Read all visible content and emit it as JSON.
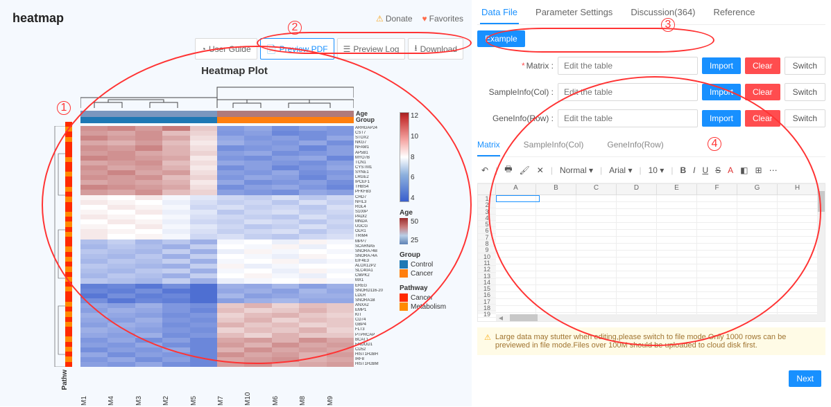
{
  "header": {
    "title": "heatmap",
    "donate": "Donate",
    "favorites": "Favorites"
  },
  "toolbar": {
    "user_guide": "User Guide",
    "preview_pdf": "Preview PDF",
    "preview_log": "Preview Log",
    "download": "Download"
  },
  "plot": {
    "title": "Heatmap Plot",
    "annot_labels": {
      "age": "Age",
      "group": "Group"
    },
    "axis_pathway": "Pathw",
    "row_names": [
      "ARHGAP24",
      "CST7",
      "STOX2",
      "NKG7",
      "NFAM1",
      "AP5B1",
      "MYO7B",
      "TCN1",
      "CYSTM1",
      "SYNE1",
      "LRGE2",
      "IPCEF1",
      "THBS4",
      "PFKFB3",
      "CHD7",
      "NFIL3",
      "RGL4",
      "S100P",
      "PADI2",
      "MNDA",
      "UGCG",
      "OLR1",
      "TRIM4",
      "MPP7",
      "SCARNA5",
      "SNORA74B",
      "SNORA74A",
      "EIF4E3",
      "ALOX12P2",
      "SLC40A1",
      "CMPK2",
      "MX1",
      "EREG",
      "SNORD116-20",
      "LDLR",
      "SNORA1B",
      "ANXA2",
      "EMP1",
      "KIT",
      "CD74",
      "GBP4",
      "FLT3",
      "PTPRCAP",
      "BCAT1",
      "ENDOD1",
      "CD52",
      "HIST1H2BH",
      "IRF8",
      "HIST1H2BM"
    ],
    "col_names": [
      "M1",
      "M4",
      "M3",
      "M2",
      "M5",
      "M7",
      "M10",
      "M6",
      "M8",
      "M9"
    ],
    "top_ann_age": [
      "#7a97bf",
      "#7a97bf",
      "#7a97bf",
      "#7a97bf",
      "#7a97bf",
      "#b07a7a",
      "#b07a7a",
      "#b07a7a",
      "#b07a7a",
      "#b07a7a"
    ],
    "top_ann_group": [
      "#1e78b4",
      "#1e78b4",
      "#1e78b4",
      "#1e78b4",
      "#1e78b4",
      "#ff7f0e",
      "#ff7f0e",
      "#ff7f0e",
      "#ff7f0e",
      "#ff7f0e"
    ],
    "row_ann": [
      "#ff2a00",
      "#ff8a00",
      "#ff2a00",
      "#ff8a00",
      "#ff2a00",
      "#ff2a00",
      "#ff2a00",
      "#ff8a00",
      "#ff2a00",
      "#ff2a00",
      "#ff8a00",
      "#ff2a00",
      "#ff2a00",
      "#ff8a00",
      "#ff2a00",
      "#ff8a00",
      "#ff2a00",
      "#ff2a00",
      "#ff8a00",
      "#ff2a00",
      "#ff8a00",
      "#ff2a00",
      "#ff8a00",
      "#ff2a00",
      "#ff2a00",
      "#ff8a00",
      "#ff2a00",
      "#ff8a00",
      "#ff2a00",
      "#ff8a00",
      "#ff2a00",
      "#ff8a00",
      "#ff2a00",
      "#ff8a00",
      "#ff2a00",
      "#ff2a00",
      "#ff8a00",
      "#ff2a00",
      "#ff8a00",
      "#ff2a00",
      "#ff8a00",
      "#ff2a00",
      "#ff2a00",
      "#ff8a00",
      "#ff2a00",
      "#ff8a00",
      "#ff2a00",
      "#ff8a00",
      "#ff2a00"
    ]
  },
  "legend": {
    "colorbar_ticks": [
      "12",
      "10",
      "8",
      "6",
      "4"
    ],
    "age": {
      "title": "Age",
      "ticks": [
        "50",
        "25"
      ]
    },
    "group": {
      "title": "Group",
      "items": [
        {
          "label": "Control",
          "color": "#1e78b4"
        },
        {
          "label": "Cancer",
          "color": "#ff7f0e"
        }
      ]
    },
    "pathway": {
      "title": "Pathway",
      "items": [
        {
          "label": "Cancer",
          "color": "#ff2a00"
        },
        {
          "label": "Metabolism",
          "color": "#ff8a00"
        }
      ]
    }
  },
  "tabs": {
    "data_file": "Data File",
    "param": "Parameter Settings",
    "discussion": "Discussion(364)",
    "reference": "Reference"
  },
  "buttons": {
    "example": "Example",
    "import": "Import",
    "clear": "Clear",
    "switch": "Switch",
    "next": "Next"
  },
  "fields": {
    "matrix": "Matrix :",
    "sampleinfo": "SampleInfo(Col) :",
    "geneinfo": "GeneInfo(Row) :",
    "placeholder": "Edit the table"
  },
  "subtabs": {
    "matrix": "Matrix",
    "sample": "SampleInfo(Col)",
    "gene": "GeneInfo(Row)"
  },
  "sheet": {
    "toolbar": {
      "undo": "↶",
      "print": "🖶",
      "paint": "🖌",
      "clearfmt": "✕",
      "normal": "Normal",
      "font": "Arial",
      "size": "10",
      "bold": "B",
      "italic": "I",
      "under": "U",
      "strike": "S",
      "color": "A",
      "fill": "◧",
      "borders": "⊞",
      "more": "⋯"
    },
    "cols": [
      "A",
      "B",
      "C",
      "D",
      "E",
      "F",
      "G",
      "H"
    ],
    "rows": [
      "1",
      "2",
      "3",
      "4",
      "5",
      "6",
      "7",
      "8",
      "9",
      "10",
      "11",
      "12",
      "13",
      "14",
      "15",
      "16",
      "17",
      "18",
      "19"
    ]
  },
  "warning": "Large data may stutter when editing,please switch to file mode.Only 1000 rows can be previewed in file mode.Files over 100M should be uploaded to cloud disk first.",
  "annotations": {
    "1": "1",
    "2": "2",
    "3": "3",
    "4": "4"
  },
  "chart_data": {
    "type": "heatmap",
    "title": "Heatmap Plot",
    "x_categories": [
      "M1",
      "M4",
      "M3",
      "M2",
      "M5",
      "M7",
      "M10",
      "M6",
      "M8",
      "M9"
    ],
    "y_categories": [
      "ARHGAP24",
      "CST7",
      "STOX2",
      "NKG7",
      "NFAM1",
      "AP5B1",
      "MYO7B",
      "TCN1",
      "CYSTM1",
      "SYNE1",
      "LRGE2",
      "IPCEF1",
      "THBS4",
      "PFKFB3",
      "CHD7",
      "NFIL3",
      "RGL4",
      "S100P",
      "PADI2",
      "MNDA",
      "UGCG",
      "OLR1",
      "TRIM4",
      "MPP7",
      "SCARNA5",
      "SNORA74B",
      "SNORA74A",
      "EIF4E3",
      "ALOX12P2",
      "SLC40A1",
      "CMPK2",
      "MX1",
      "EREG",
      "SNORD116-20",
      "LDLR",
      "SNORA1B",
      "ANXA2",
      "EMP1",
      "KIT",
      "CD74",
      "GBP4",
      "FLT3",
      "PTPRCAP",
      "BCAT1",
      "ENDOD1",
      "CD52",
      "HIST1H2BH",
      "IRF8",
      "HIST1H2BM"
    ],
    "color_scale": {
      "min": 4,
      "max": 12,
      "low": "#3a5fcd",
      "mid": "#ffffff",
      "high": "#a02222"
    },
    "col_annotations": {
      "Age": [
        30,
        28,
        32,
        29,
        31,
        48,
        50,
        47,
        49,
        46
      ],
      "Group": [
        "Control",
        "Control",
        "Control",
        "Control",
        "Control",
        "Cancer",
        "Cancer",
        "Cancer",
        "Cancer",
        "Cancer"
      ]
    },
    "row_annotation_pathway": [
      "Cancer",
      "Metabolism",
      "Cancer",
      "Metabolism",
      "Cancer",
      "Cancer",
      "Cancer",
      "Metabolism",
      "Cancer",
      "Cancer",
      "Metabolism",
      "Cancer",
      "Cancer",
      "Metabolism",
      "Cancer",
      "Metabolism",
      "Cancer",
      "Cancer",
      "Metabolism",
      "Cancer",
      "Metabolism",
      "Cancer",
      "Metabolism",
      "Cancer",
      "Cancer",
      "Metabolism",
      "Cancer",
      "Metabolism",
      "Cancer",
      "Metabolism",
      "Cancer",
      "Metabolism",
      "Cancer",
      "Metabolism",
      "Cancer",
      "Cancer",
      "Metabolism",
      "Cancer",
      "Metabolism",
      "Cancer",
      "Metabolism",
      "Cancer",
      "Cancer",
      "Metabolism",
      "Cancer",
      "Metabolism",
      "Cancer",
      "Metabolism",
      "Cancer"
    ],
    "matrix": [
      [
        10.0,
        10.2,
        9.8,
        10.4,
        9.0,
        5.5,
        5.8,
        5.2,
        5.6,
        5.4
      ],
      [
        9.8,
        9.6,
        10.0,
        9.2,
        8.8,
        5.4,
        5.6,
        5.0,
        5.2,
        5.4
      ],
      [
        10.2,
        9.8,
        10.0,
        9.6,
        8.6,
        5.8,
        5.4,
        5.6,
        5.2,
        5.8
      ],
      [
        9.6,
        9.4,
        9.8,
        9.2,
        8.4,
        6.0,
        5.6,
        5.4,
        5.8,
        5.2
      ],
      [
        10.0,
        9.8,
        10.2,
        9.4,
        8.6,
        5.2,
        5.4,
        5.6,
        5.0,
        5.6
      ],
      [
        9.8,
        10.0,
        9.6,
        9.4,
        8.8,
        5.6,
        5.8,
        5.2,
        5.4,
        5.6
      ],
      [
        10.2,
        10.0,
        9.8,
        9.6,
        8.4,
        5.4,
        5.2,
        5.6,
        5.8,
        5.0
      ],
      [
        9.6,
        9.8,
        10.0,
        9.2,
        8.6,
        5.8,
        5.6,
        5.4,
        5.2,
        5.6
      ],
      [
        10.0,
        9.6,
        9.8,
        9.4,
        8.4,
        5.2,
        5.6,
        5.0,
        5.4,
        5.8
      ],
      [
        9.8,
        10.2,
        9.6,
        9.8,
        8.6,
        5.6,
        5.4,
        5.8,
        5.2,
        5.4
      ],
      [
        10.0,
        9.8,
        10.0,
        9.2,
        8.8,
        5.4,
        5.8,
        5.6,
        5.0,
        5.6
      ],
      [
        9.6,
        9.8,
        9.6,
        9.4,
        8.4,
        5.8,
        5.2,
        5.4,
        5.6,
        5.2
      ],
      [
        10.2,
        10.0,
        9.8,
        9.6,
        8.6,
        5.2,
        5.6,
        5.8,
        5.4,
        5.0
      ],
      [
        9.8,
        9.6,
        10.0,
        9.2,
        8.8,
        5.6,
        5.4,
        5.2,
        5.8,
        5.6
      ],
      [
        8.2,
        8.0,
        8.4,
        7.8,
        7.4,
        7.0,
        6.8,
        7.2,
        6.6,
        7.0
      ],
      [
        8.4,
        8.2,
        8.0,
        7.6,
        7.2,
        6.8,
        7.0,
        6.6,
        7.2,
        6.8
      ],
      [
        8.0,
        8.4,
        8.2,
        7.8,
        7.0,
        7.2,
        6.8,
        7.0,
        6.6,
        7.2
      ],
      [
        8.2,
        8.0,
        8.4,
        7.6,
        7.4,
        6.6,
        7.0,
        7.2,
        6.8,
        7.0
      ],
      [
        8.4,
        8.2,
        8.0,
        7.8,
        7.2,
        7.0,
        6.8,
        6.6,
        7.2,
        6.8
      ],
      [
        8.0,
        8.4,
        8.2,
        7.6,
        7.0,
        6.8,
        7.2,
        7.0,
        6.6,
        7.0
      ],
      [
        8.2,
        8.0,
        8.4,
        7.8,
        7.4,
        7.0,
        6.6,
        6.8,
        7.2,
        6.8
      ],
      [
        8.4,
        8.2,
        8.0,
        7.6,
        7.2,
        6.8,
        7.0,
        7.2,
        6.6,
        7.0
      ],
      [
        8.4,
        8.0,
        8.2,
        7.8,
        7.0,
        7.2,
        6.8,
        6.6,
        7.0,
        7.2
      ],
      [
        6.4,
        6.8,
        6.2,
        6.6,
        6.0,
        7.8,
        8.0,
        7.6,
        8.2,
        7.8
      ],
      [
        6.2,
        6.6,
        6.4,
        6.0,
        6.8,
        8.0,
        7.8,
        8.2,
        7.6,
        8.0
      ],
      [
        6.6,
        6.4,
        6.2,
        6.8,
        6.0,
        7.6,
        8.2,
        7.8,
        8.0,
        7.8
      ],
      [
        6.4,
        6.2,
        6.6,
        6.0,
        6.8,
        8.0,
        7.8,
        7.6,
        8.2,
        8.0
      ],
      [
        6.2,
        6.6,
        6.4,
        6.8,
        6.0,
        7.8,
        8.0,
        8.2,
        7.6,
        7.8
      ],
      [
        6.6,
        6.4,
        6.2,
        6.0,
        6.8,
        8.2,
        7.6,
        7.8,
        8.0,
        8.0
      ],
      [
        6.4,
        6.2,
        6.6,
        6.8,
        6.0,
        7.8,
        8.0,
        7.6,
        8.2,
        7.8
      ],
      [
        6.2,
        6.6,
        6.4,
        6.0,
        6.8,
        8.0,
        8.2,
        7.8,
        7.6,
        8.0
      ],
      [
        6.6,
        6.4,
        6.2,
        6.8,
        6.0,
        7.6,
        7.8,
        8.0,
        8.2,
        7.8
      ],
      [
        4.8,
        5.0,
        4.6,
        5.2,
        4.4,
        6.0,
        5.8,
        6.2,
        5.6,
        6.0
      ],
      [
        5.0,
        4.8,
        5.2,
        4.6,
        4.4,
        5.8,
        6.0,
        5.6,
        6.2,
        5.8
      ],
      [
        4.6,
        5.2,
        4.8,
        5.0,
        4.4,
        6.2,
        5.6,
        5.8,
        6.0,
        6.0
      ],
      [
        5.2,
        4.6,
        5.0,
        4.8,
        4.4,
        5.6,
        6.0,
        6.2,
        5.8,
        5.8
      ],
      [
        5.8,
        5.6,
        6.0,
        5.4,
        5.2,
        9.0,
        9.4,
        8.8,
        9.2,
        9.0
      ],
      [
        5.6,
        6.0,
        5.8,
        5.4,
        5.0,
        9.2,
        8.8,
        9.0,
        9.4,
        9.0
      ],
      [
        6.0,
        5.8,
        5.6,
        5.2,
        5.4,
        8.8,
        9.2,
        9.4,
        9.0,
        8.8
      ],
      [
        5.8,
        5.6,
        6.0,
        5.4,
        5.2,
        9.0,
        9.4,
        8.8,
        9.2,
        9.0
      ],
      [
        5.6,
        6.0,
        5.8,
        5.2,
        5.4,
        9.4,
        9.0,
        9.2,
        8.8,
        9.0
      ],
      [
        6.0,
        5.8,
        5.6,
        5.4,
        5.2,
        8.8,
        9.2,
        9.0,
        9.4,
        8.8
      ],
      [
        5.8,
        5.6,
        6.0,
        5.2,
        5.4,
        9.2,
        8.8,
        9.4,
        9.0,
        9.0
      ],
      [
        5.4,
        5.8,
        5.2,
        5.6,
        5.0,
        9.6,
        9.8,
        9.4,
        10.0,
        9.6
      ],
      [
        5.6,
        5.4,
        5.8,
        5.2,
        5.0,
        9.8,
        9.4,
        10.0,
        9.6,
        9.8
      ],
      [
        5.2,
        5.6,
        5.4,
        5.8,
        5.0,
        9.4,
        10.0,
        9.6,
        9.8,
        9.6
      ],
      [
        5.8,
        5.2,
        5.6,
        5.4,
        5.0,
        10.0,
        9.6,
        9.8,
        9.4,
        9.8
      ],
      [
        5.4,
        5.8,
        5.2,
        5.6,
        5.0,
        9.6,
        9.8,
        10.0,
        9.4,
        9.6
      ],
      [
        5.6,
        5.4,
        5.8,
        5.2,
        5.0,
        9.8,
        10.0,
        9.4,
        9.6,
        9.8
      ]
    ]
  }
}
